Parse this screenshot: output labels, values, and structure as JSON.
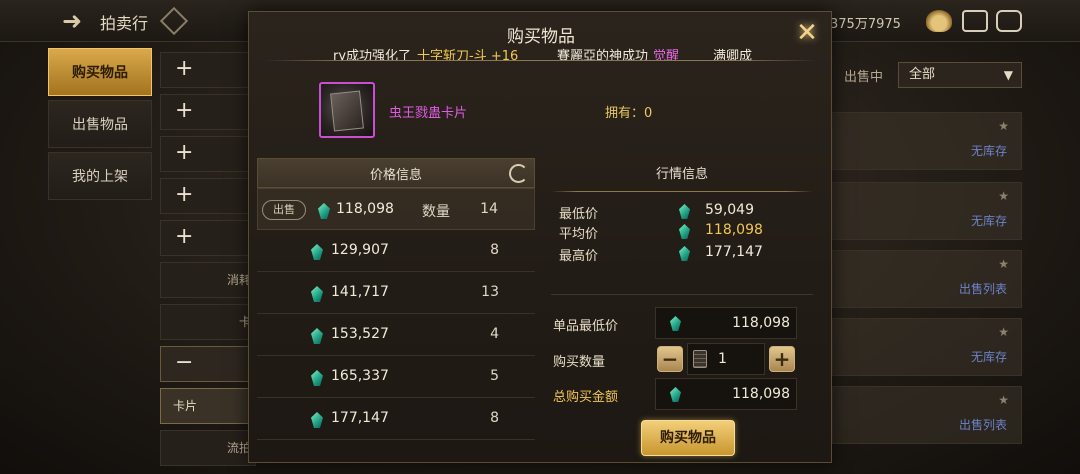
{
  "header": {
    "title": "拍卖行",
    "currency": "375万7975"
  },
  "side_tabs": [
    "购买物品",
    "出售物品",
    "我的上架"
  ],
  "background": {
    "sell_filter_label": "出售中",
    "filter_value": "全部",
    "card_status": [
      "无库存",
      "无库存",
      "出售列表",
      "无库存",
      "出售列表"
    ],
    "category_rows": [
      "+",
      "+",
      "+",
      "+",
      "+",
      "消耗",
      "卡",
      "−",
      "卡片",
      "流拍"
    ]
  },
  "modal": {
    "title": "购买物品",
    "ticker": {
      "part1": "ry成功强化了",
      "item1": "十字斩刀-斗 +16",
      "part2": "賽麗亞的神成功",
      "awaken": "觉醒",
      "part3": "满卿成"
    },
    "item": {
      "name": "虫王戮蛊卡片",
      "own_label": "拥有：0"
    },
    "price_info": {
      "header": "价格信息",
      "sell_tag": "出售",
      "qty_label": "数量",
      "rows": [
        {
          "price": "118,098",
          "qty": "14"
        },
        {
          "price": "129,907",
          "qty": "8"
        },
        {
          "price": "141,717",
          "qty": "13"
        },
        {
          "price": "153,527",
          "qty": "4"
        },
        {
          "price": "165,337",
          "qty": "5"
        },
        {
          "price": "177,147",
          "qty": "8"
        }
      ]
    },
    "market_info": {
      "header": "行情信息",
      "min_label": "最低价",
      "min_value": "59,049",
      "avg_label": "平均价",
      "avg_value": "118,098",
      "max_label": "最高价",
      "max_value": "177,147"
    },
    "form": {
      "unit_min_label": "单品最低价",
      "unit_min_value": "118,098",
      "qty_label": "购买数量",
      "qty_value": "1",
      "total_label": "总购买金额",
      "total_value": "118,098",
      "minus": "−",
      "plus": "+"
    },
    "buy_button": "购买物品",
    "close": "✕"
  }
}
